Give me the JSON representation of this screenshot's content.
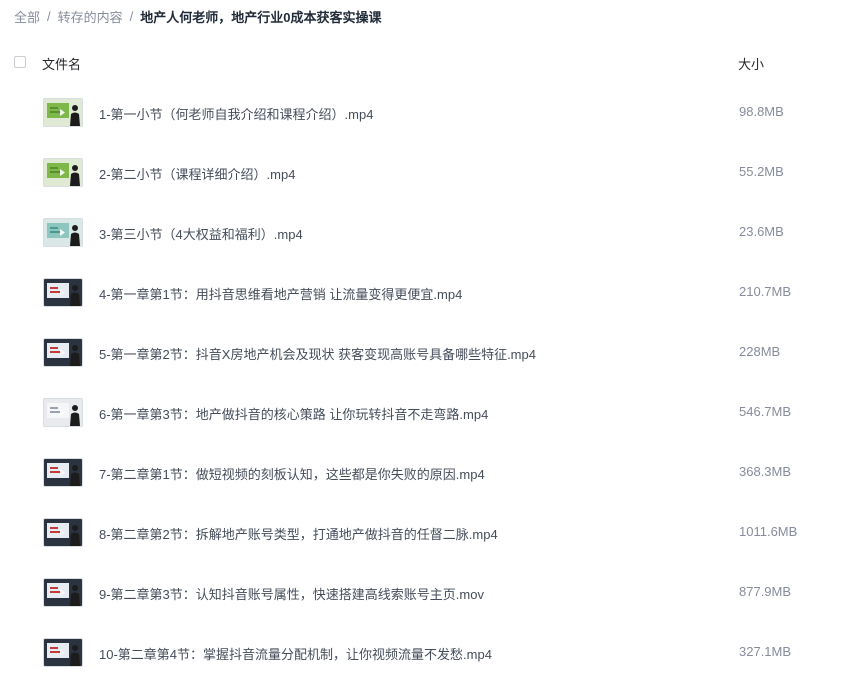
{
  "breadcrumb": {
    "root": "全部",
    "parent": "转存的内容",
    "current": "地产人何老师，地产行业0成本获客实操课",
    "separator": "/"
  },
  "table": {
    "col_name": "文件名",
    "col_size": "大小"
  },
  "files": [
    {
      "name": "1-第一小节（何老师自我介绍和课程介绍）.mp4",
      "size": "98.8MB",
      "thumb": "green"
    },
    {
      "name": "2-第二小节（课程详细介绍）.mp4",
      "size": "55.2MB",
      "thumb": "green"
    },
    {
      "name": "3-第三小节（4大权益和福利）.mp4",
      "size": "23.6MB",
      "thumb": "teal"
    },
    {
      "name": "4-第一章第1节：用抖音思维看地产营销 让流量变得更便宜.mp4",
      "size": "210.7MB",
      "thumb": "dark"
    },
    {
      "name": "5-第一章第2节：抖音X房地产机会及现状 获客变现高账号具备哪些特征.mp4",
      "size": "228MB",
      "thumb": "dark"
    },
    {
      "name": "6-第一章第3节：地产做抖音的核心策路 让你玩转抖音不走弯路.mp4",
      "size": "546.7MB",
      "thumb": "light"
    },
    {
      "name": "7-第二章第1节：做短视频的刻板认知，这些都是你失败的原因.mp4",
      "size": "368.3MB",
      "thumb": "dark"
    },
    {
      "name": "8-第二章第2节：拆解地产账号类型，打通地产做抖音的任督二脉.mp4",
      "size": "1011.6MB",
      "thumb": "dark"
    },
    {
      "name": "9-第二章第3节：认知抖音账号属性，快速搭建高线索账号主页.mov",
      "size": "877.9MB",
      "thumb": "dark"
    },
    {
      "name": "10-第二章第4节：掌握抖音流量分配机制，让你视频流量不发愁.mp4",
      "size": "327.1MB",
      "thumb": "dark"
    }
  ]
}
